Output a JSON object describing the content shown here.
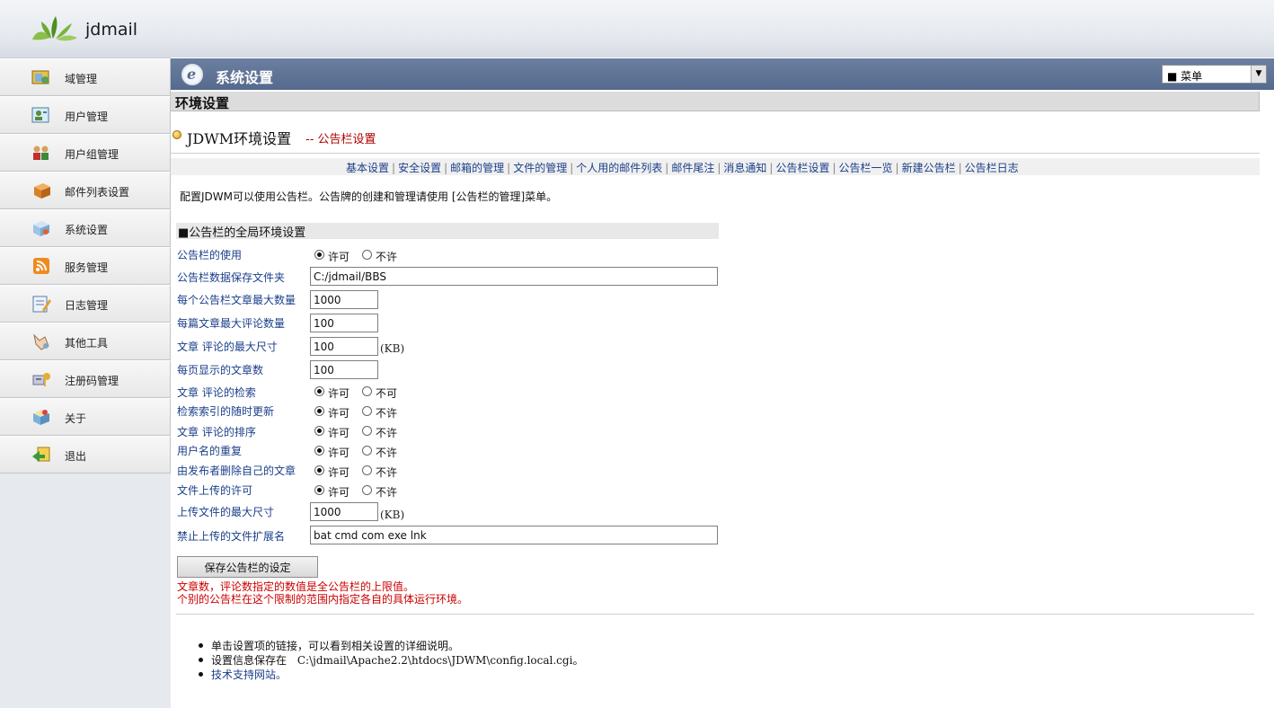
{
  "app": {
    "logo_text": "jdmail"
  },
  "sidebar": {
    "items": [
      {
        "label": "域管理",
        "icon": "domain-folder-icon"
      },
      {
        "label": "用户管理",
        "icon": "user-card-icon"
      },
      {
        "label": "用户组管理",
        "icon": "user-group-icon"
      },
      {
        "label": "邮件列表设置",
        "icon": "mail-list-box-icon"
      },
      {
        "label": "系统设置",
        "icon": "system-settings-icon"
      },
      {
        "label": "服务管理",
        "icon": "rss-service-icon"
      },
      {
        "label": "日志管理",
        "icon": "log-edit-icon"
      },
      {
        "label": "其他工具",
        "icon": "tools-hand-icon"
      },
      {
        "label": "注册码管理",
        "icon": "register-key-icon"
      },
      {
        "label": "关于",
        "icon": "about-box-icon"
      },
      {
        "label": "退出",
        "icon": "exit-arrow-icon"
      }
    ]
  },
  "header": {
    "title": "系统设置",
    "menu_select": "■ 菜单"
  },
  "section": {
    "title": "环境设置"
  },
  "page": {
    "heading": "JDWM环境设置",
    "subheading": "-- 公告栏设置",
    "intro": "配置JDWM可以使用公告栏。公告牌的创建和管理请使用 [公告栏的管理]菜单。"
  },
  "nav": {
    "links": [
      "基本设置",
      "安全设置",
      "邮箱的管理",
      "文件的管理",
      "个人用的邮件列表",
      "邮件尾注",
      "消息通知",
      "公告栏设置",
      "公告栏一览",
      "新建公告栏",
      "公告栏日志"
    ]
  },
  "settings": {
    "section_title": "■公告栏的全局环境设置",
    "bbs_use": {
      "label": "公告栏的使用",
      "opt_yes": "许可",
      "opt_no": "不许",
      "selected": "yes"
    },
    "data_folder": {
      "label": "公告栏数据保存文件夹",
      "value": "C:/jdmail/BBS"
    },
    "max_articles": {
      "label": "每个公告栏文章最大数量",
      "value": "1000"
    },
    "max_comments": {
      "label": "每篇文章最大评论数量",
      "value": "100"
    },
    "max_size": {
      "label": "文章 评论的最大尺寸",
      "value": "100",
      "unit": "(KB)"
    },
    "per_page": {
      "label": "每页显示的文章数",
      "value": "100"
    },
    "search": {
      "label": "文章 评论的检索",
      "opt_yes": "许可",
      "opt_no": "不可",
      "selected": "yes"
    },
    "index_update": {
      "label": "检索索引的随时更新",
      "opt_yes": "许可",
      "opt_no": "不许",
      "selected": "yes"
    },
    "sort": {
      "label": "文章 评论的排序",
      "opt_yes": "许可",
      "opt_no": "不许",
      "selected": "yes"
    },
    "dup_user": {
      "label": "用户名的重复",
      "opt_yes": "许可",
      "opt_no": "不许",
      "selected": "yes"
    },
    "self_delete": {
      "label": "由发布者删除自己的文章",
      "opt_yes": "许可",
      "opt_no": "不许",
      "selected": "yes"
    },
    "upload_allow": {
      "label": "文件上传的许可",
      "opt_yes": "许可",
      "opt_no": "不许",
      "selected": "yes"
    },
    "upload_max": {
      "label": "上传文件的最大尺寸",
      "value": "1000",
      "unit": "(KB)"
    },
    "blocked_ext": {
      "label": "禁止上传的文件扩展名",
      "value": "bat cmd com exe lnk"
    },
    "save_button": "保存公告栏的设定",
    "note1": "文章数，评论数指定的数值是全公告栏的上限值。",
    "note2": "个别的公告栏在这个限制的范围内指定各自的具体运行环境。"
  },
  "footer": {
    "item1": "单击设置项的链接，可以看到相关设置的详细说明。",
    "item2_prefix": "设置信息保存在",
    "item2_path": "C:\\jdmail\\Apache2.2\\htdocs\\JDWM\\config.local.cgi",
    "item2_suffix": "。",
    "item3": "技术支持网站。"
  },
  "colors": {
    "titlebar": "#5e7297",
    "link": "#1a3f8a",
    "note_red": "#cc0000",
    "sub_red": "#b00000"
  }
}
